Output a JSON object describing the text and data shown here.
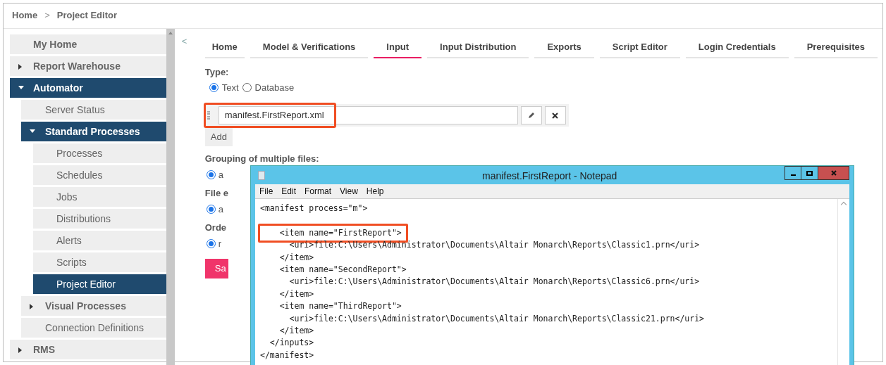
{
  "breadcrumb": {
    "items": [
      "Home",
      "Project Editor"
    ],
    "separator": ">"
  },
  "sidebar": {
    "items": [
      {
        "label": "My Home",
        "selected": false
      },
      {
        "label": "Report Warehouse",
        "selected": false,
        "expanded": false
      },
      {
        "label": "Automator",
        "selected": true,
        "expanded": true,
        "children": [
          {
            "label": "Server Status",
            "selected": false
          },
          {
            "label": "Standard Processes",
            "selected": true,
            "expanded": true,
            "children": [
              {
                "label": "Processes",
                "selected": false
              },
              {
                "label": "Schedules",
                "selected": false
              },
              {
                "label": "Jobs",
                "selected": false
              },
              {
                "label": "Distributions",
                "selected": false
              },
              {
                "label": "Alerts",
                "selected": false
              },
              {
                "label": "Scripts",
                "selected": false
              },
              {
                "label": "Project Editor",
                "selected": true
              }
            ]
          },
          {
            "label": "Visual Processes",
            "selected": false,
            "expanded": false
          },
          {
            "label": "Connection Definitions",
            "selected": false
          }
        ]
      },
      {
        "label": "RMS",
        "selected": false,
        "expanded": false
      }
    ]
  },
  "collapse_toggle": "<",
  "tabs": [
    {
      "label": "Home",
      "selected": false
    },
    {
      "label": "Model & Verifications",
      "selected": false
    },
    {
      "label": "Input",
      "selected": true
    },
    {
      "label": "Input Distribution",
      "selected": false
    },
    {
      "label": "Exports",
      "selected": false
    },
    {
      "label": "Script Editor",
      "selected": false
    },
    {
      "label": "Login Credentials",
      "selected": false
    },
    {
      "label": "Prerequisites",
      "selected": false
    }
  ],
  "type": {
    "label": "Type:",
    "options": [
      {
        "label": "Text",
        "selected": true
      },
      {
        "label": "Database",
        "selected": false
      }
    ]
  },
  "file_field": {
    "value": "manifest.FirstReport.xml",
    "highlighted": true
  },
  "add_button": "Add",
  "form_sections": [
    {
      "label": "Grouping of multiple files:",
      "option": "a",
      "selected": true
    },
    {
      "label": "File e",
      "option": "a",
      "selected": true
    },
    {
      "label": "Orde",
      "option": "r",
      "selected": true
    }
  ],
  "save_button": "Sa",
  "notepad": {
    "title": "manifest.FirstReport - Notepad",
    "menu": [
      "File",
      "Edit",
      "Format",
      "View",
      "Help"
    ],
    "lines": [
      {
        "text": "<manifest process=\"m\">",
        "highlighted": false
      },
      {
        "text": "    <item name=\"FirstReport\">",
        "highlighted": true
      },
      {
        "text": "      <uri>file:C:\\Users\\Administrator\\Documents\\Altair Monarch\\Reports\\Classic1.prn</uri>",
        "highlighted": false
      },
      {
        "text": "    </item>",
        "highlighted": false
      },
      {
        "text": "    <item name=\"SecondReport\">",
        "highlighted": false
      },
      {
        "text": "      <uri>file:C:\\Users\\Administrator\\Documents\\Altair Monarch\\Reports\\Classic6.prn</uri>",
        "highlighted": false
      },
      {
        "text": "    </item>",
        "highlighted": false
      },
      {
        "text": "    <item name=\"ThirdReport\">",
        "highlighted": false
      },
      {
        "text": "      <uri>file:C:\\Users\\Administrator\\Documents\\Altair Monarch\\Reports\\Classic21.prn</uri>",
        "highlighted": false
      },
      {
        "text": "    </item>",
        "highlighted": false
      },
      {
        "text": "  </inputs>",
        "highlighted": false
      },
      {
        "text": "</manifest>",
        "highlighted": false
      }
    ]
  }
}
